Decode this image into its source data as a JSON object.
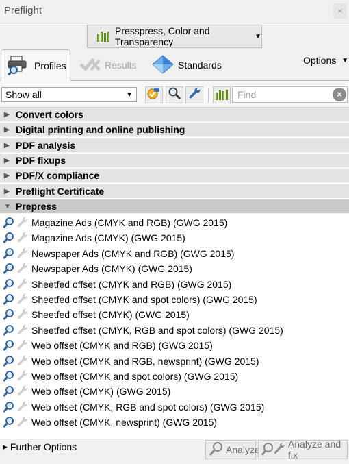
{
  "window": {
    "title": "Preflight",
    "close_glyph": "×"
  },
  "category_dropdown": {
    "label": "Presspress, Color and Transparency",
    "icon": "bars-icon"
  },
  "tabs": [
    {
      "label": "Profiles",
      "icon": "printer-magnifier-icon",
      "state": "active"
    },
    {
      "label": "Results",
      "icon": "results-icon",
      "state": "disabled"
    },
    {
      "label": "Standards",
      "icon": "diamond-icon",
      "state": "normal"
    }
  ],
  "options_label": "Options",
  "filter": {
    "show_all": "Show all",
    "find_placeholder": "Find",
    "clear_glyph": "×"
  },
  "categories": [
    {
      "label": "Convert colors",
      "expanded": false
    },
    {
      "label": "Digital printing and online publishing",
      "expanded": false
    },
    {
      "label": "PDF analysis",
      "expanded": false
    },
    {
      "label": "PDF fixups",
      "expanded": false
    },
    {
      "label": "PDF/X compliance",
      "expanded": false
    },
    {
      "label": "Preflight Certificate",
      "expanded": false
    },
    {
      "label": "Prepress",
      "expanded": true
    }
  ],
  "profiles": [
    "Magazine Ads (CMYK and RGB) (GWG 2015)",
    "Magazine Ads (CMYK) (GWG 2015)",
    "Newspaper Ads (CMYK and RGB) (GWG 2015)",
    "Newspaper Ads (CMYK) (GWG 2015)",
    "Sheetfed offset (CMYK and RGB) (GWG 2015)",
    "Sheetfed offset (CMYK and spot colors) (GWG 2015)",
    "Sheetfed offset (CMYK) (GWG 2015)",
    "Sheetfed offset (CMYK, RGB and spot colors) (GWG 2015)",
    "Web offset (CMYK and RGB) (GWG 2015)",
    "Web offset (CMYK and RGB, newsprint) (GWG 2015)",
    "Web offset (CMYK and spot colors) (GWG 2015)",
    "Web offset (CMYK) (GWG 2015)",
    "Web offset (CMYK, RGB and spot colors) (GWG 2015)",
    "Web offset (CMYK, newsprint) (GWG 2015)"
  ],
  "bottom": {
    "further_options": "Further Options",
    "analyze": "Analyze",
    "analyze_fix": "Analyze and fix"
  },
  "colors": {
    "accent_green": "#8ab536",
    "diamond_blue": "#4a90d9",
    "wrench_blue": "#2f6fb5"
  }
}
